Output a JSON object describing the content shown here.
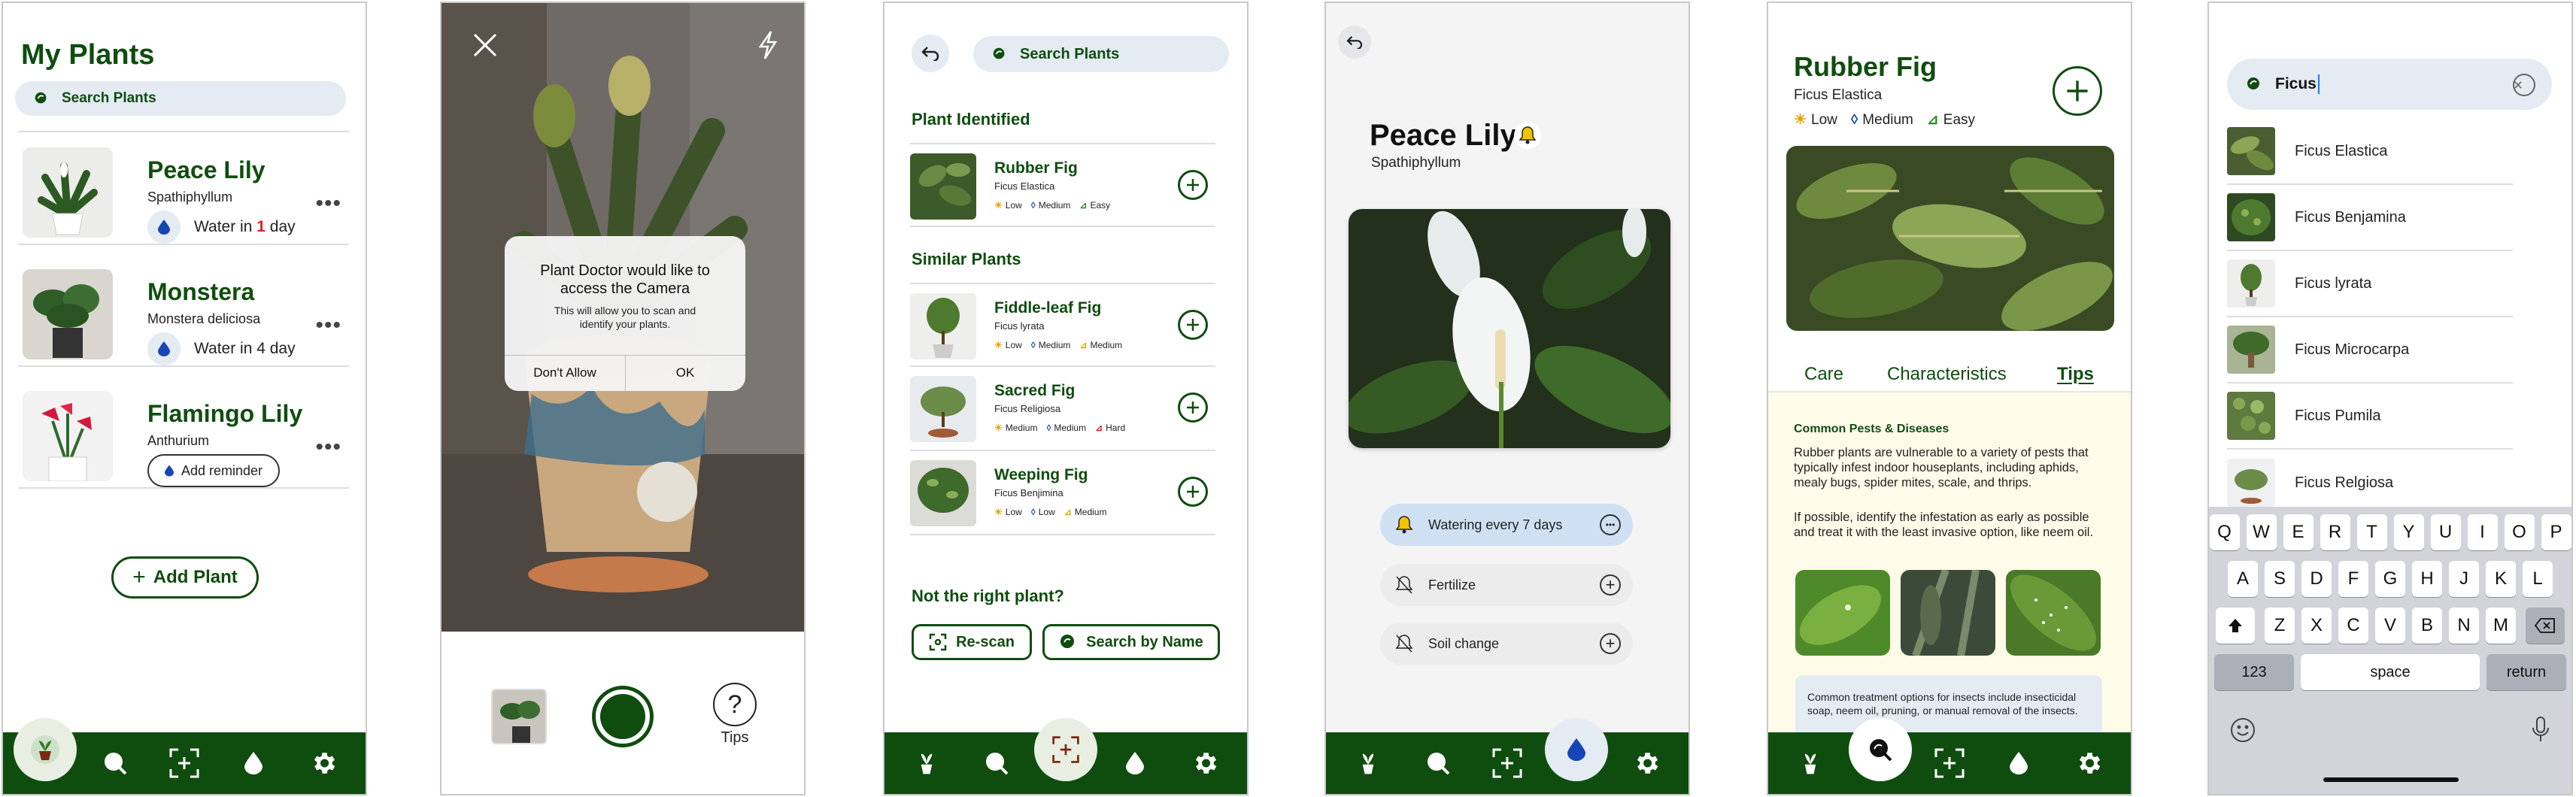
{
  "screen1": {
    "title": "My Plants",
    "search_placeholder": "Search Plants",
    "plants": [
      {
        "name": "Peace Lily",
        "scientific": "Spathiphyllum",
        "water_prefix": "Water in ",
        "water_num": "1",
        "water_suffix": " day"
      },
      {
        "name": "Monstera",
        "scientific": "Monstera deliciosa",
        "water_text": "Water in 4 day"
      },
      {
        "name": "Flamingo Lily",
        "scientific": "Anthurium",
        "reminder_button": "Add reminder"
      }
    ],
    "add_plant_button": "Add Plant"
  },
  "screen2": {
    "dialog_title": "Plant Doctor would like to access the Camera",
    "dialog_body": "This will allow you to scan and identify your plants.",
    "dont_allow": "Don't Allow",
    "ok": "OK",
    "tips_label": "Tips"
  },
  "screen3": {
    "search_label": "Search Plants",
    "identified_title": "Plant Identified",
    "identified": {
      "name": "Rubber Fig",
      "scientific": "Ficus Elastica",
      "light": "Low",
      "water": "Medium",
      "difficulty": "Easy"
    },
    "similar_title": "Similar Plants",
    "similar": [
      {
        "name": "Fiddle-leaf Fig",
        "scientific": "Ficus lyrata",
        "light": "Low",
        "water": "Medium",
        "difficulty": "Medium"
      },
      {
        "name": "Sacred Fig",
        "scientific": "Ficus Religiosa",
        "light": "Medium",
        "water": "Medium",
        "difficulty": "Hard"
      },
      {
        "name": "Weeping Fig",
        "scientific": "Ficus Benjimina",
        "light": "Low",
        "water": "Low",
        "difficulty": "Medium"
      }
    ],
    "not_right_title": "Not the right plant?",
    "rescan_button": "Re-scan",
    "search_name_button": "Search by Name"
  },
  "screen4": {
    "name": "Peace Lily",
    "scientific": "Spathiphyllum",
    "reminders": [
      "Watering every 7 days",
      "Fertilize",
      "Soil change"
    ]
  },
  "screen5": {
    "name": "Rubber Fig",
    "scientific": "Ficus Elastica",
    "light": "Low",
    "water": "Medium",
    "difficulty": "Easy",
    "tabs": [
      "Care",
      "Characteristics",
      "Tips"
    ],
    "active_tab": "Tips",
    "tips_heading": "Common Pests & Diseases",
    "tips_p1": "Rubber plants are vulnerable to a variety of pests that typically infest indoor houseplants, including aphids, mealy bugs, spider mites, scale, and thrips.",
    "tips_p2": "If possible, identify the infestation as early as possible and treat it with the least invasive option, like neem oil.",
    "treatment": "Common treatment options for insects include insecticidal soap, neem oil, pruning, or manual removal of the insects."
  },
  "screen6": {
    "query": "Ficus",
    "suggestions": [
      "Ficus Elastica",
      "Ficus Benjamina",
      "Ficus lyrata",
      "Ficus Microcarpa",
      "Ficus Pumila",
      "Ficus Relgiosa"
    ],
    "keys_row1": [
      "Q",
      "W",
      "E",
      "R",
      "T",
      "Y",
      "U",
      "I",
      "O",
      "P"
    ],
    "keys_row2": [
      "A",
      "S",
      "D",
      "F",
      "G",
      "H",
      "J",
      "K",
      "L"
    ],
    "keys_row3": [
      "Z",
      "X",
      "C",
      "V",
      "B",
      "N",
      "M"
    ],
    "key_123": "123",
    "key_space": "space",
    "key_return": "return"
  },
  "colors": {
    "brand_green": "#0f4d0f",
    "search_bg": "#e4ebf3",
    "reminder_active": "#cfe0f3",
    "tips_bg": "#fffbe9"
  }
}
